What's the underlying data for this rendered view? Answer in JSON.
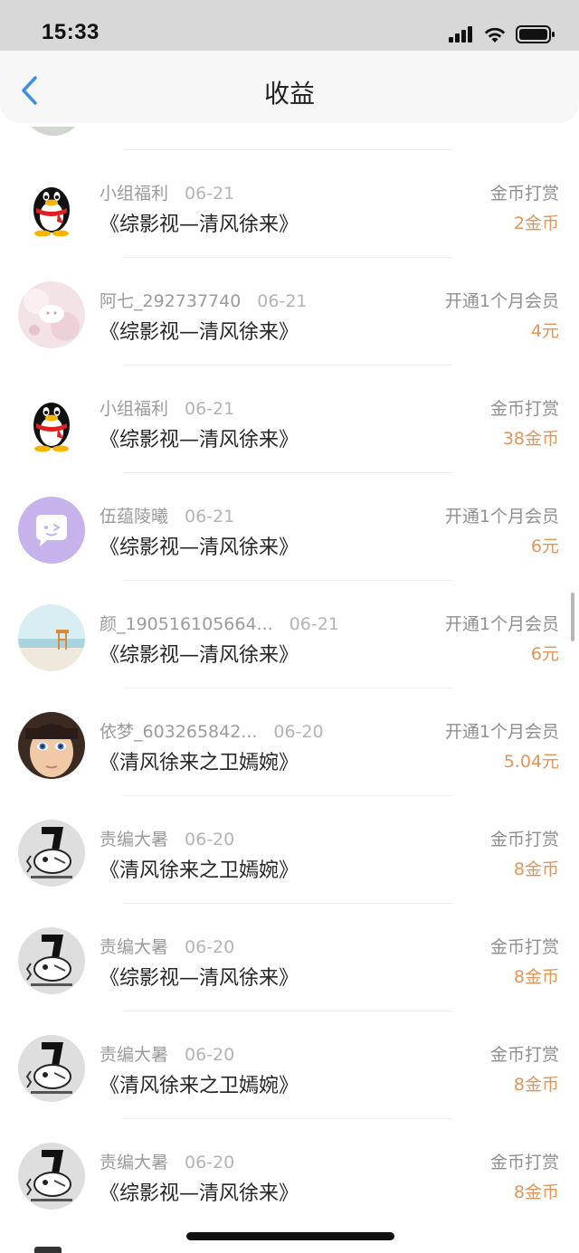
{
  "status_bar": {
    "time": "15:33",
    "icons": [
      "signal-icon",
      "wifi-icon",
      "battery-icon"
    ]
  },
  "nav": {
    "back_icon": "chevron-left-icon",
    "title": "收益"
  },
  "colors": {
    "accent_blue": "#3d8fe0",
    "amount_orange": "#e0965a",
    "secondary_gray": "#9b9b9b"
  },
  "rows": [
    {
      "avatar": "penguin-avatar",
      "name": "小组福利",
      "date": "06-21",
      "book": "《综影视—清风徐来》",
      "type": "金币打赏",
      "amount": "2金币"
    },
    {
      "avatar": "pink-cat-avatar",
      "name": "阿七_292737740",
      "date": "06-21",
      "book": "《综影视—清风徐来》",
      "type": "开通1个月会员",
      "amount": "4元"
    },
    {
      "avatar": "penguin-avatar",
      "name": "小组福利",
      "date": "06-21",
      "book": "《综影视—清风徐来》",
      "type": "金币打赏",
      "amount": "38金币"
    },
    {
      "avatar": "purple-chat-avatar",
      "name": "伍蕴陵曦",
      "date": "06-21",
      "book": "《综影视—清风徐来》",
      "type": "开通1个月会员",
      "amount": "6元"
    },
    {
      "avatar": "beach-avatar",
      "name": "颜_190516105664...",
      "date": "06-21",
      "book": "《综影视—清风徐来》",
      "type": "开通1个月会员",
      "amount": "6元"
    },
    {
      "avatar": "face-avatar",
      "name": "依梦_603265842...",
      "date": "06-20",
      "book": "《清风徐来之卫嫣婉》",
      "type": "开通1个月会员",
      "amount": "5.04元"
    },
    {
      "avatar": "chainsaw-avatar",
      "name": "责编大暑",
      "date": "06-20",
      "book": "《清风徐来之卫嫣婉》",
      "type": "金币打赏",
      "amount": "8金币"
    },
    {
      "avatar": "chainsaw-avatar",
      "name": "责编大暑",
      "date": "06-20",
      "book": "《综影视—清风徐来》",
      "type": "金币打赏",
      "amount": "8金币"
    },
    {
      "avatar": "chainsaw-avatar",
      "name": "责编大暑",
      "date": "06-20",
      "book": "《清风徐来之卫嫣婉》",
      "type": "金币打赏",
      "amount": "8金币"
    },
    {
      "avatar": "chainsaw-avatar",
      "name": "责编大暑",
      "date": "06-20",
      "book": "《综影视—清风徐来》",
      "type": "金币打赏",
      "amount": "8金币"
    }
  ]
}
